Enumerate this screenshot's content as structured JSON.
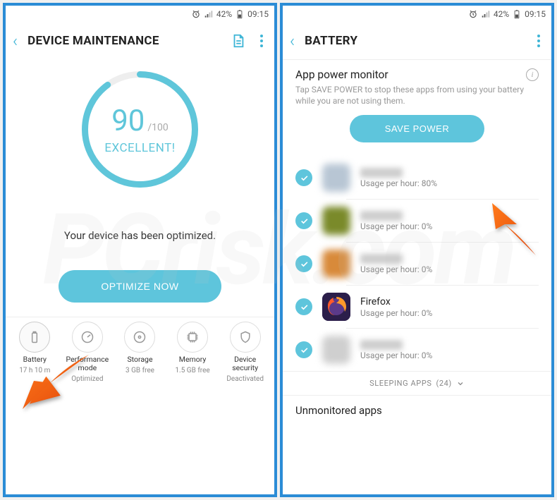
{
  "status": {
    "battery_pct": "42%",
    "time": "09:15"
  },
  "screen1": {
    "title": "DEVICE MAINTENANCE",
    "score": "90",
    "score_max": "/100",
    "rating": "EXCELLENT!",
    "message": "Your device has been optimized.",
    "optimize_btn": "OPTIMIZE NOW",
    "tiles": [
      {
        "label": "Battery",
        "sub": "17 h 10 m"
      },
      {
        "label": "Performance mode",
        "sub": "Optimized"
      },
      {
        "label": "Storage",
        "sub": "3 GB free"
      },
      {
        "label": "Memory",
        "sub": "1.5 GB free"
      },
      {
        "label": "Device security",
        "sub": "Deactivated"
      }
    ]
  },
  "screen2": {
    "title": "BATTERY",
    "section_title": "App power monitor",
    "section_desc": "Tap SAVE POWER to stop these apps from using your battery while you are not using them.",
    "save_btn": "SAVE POWER",
    "apps": [
      {
        "name": "",
        "usage": "Usage per hour: 80%",
        "blurred": true,
        "iconColor": "#b8c6d4"
      },
      {
        "name": "",
        "usage": "Usage per hour: 0%",
        "blurred": true,
        "iconColor": "#7a8a2a"
      },
      {
        "name": "",
        "usage": "Usage per hour: 0%",
        "blurred": true,
        "iconColor": "#d88a3a"
      },
      {
        "name": "Firefox",
        "usage": "Usage per hour: 0%",
        "blurred": false,
        "iconColor": "#2b1e4a"
      },
      {
        "name": "",
        "usage": "Usage per hour: 0%",
        "blurred": true,
        "iconColor": "#cfcfcf"
      }
    ],
    "sleeping_label": "SLEEPING APPS",
    "sleeping_count": "(24)",
    "unmonitored_title": "Unmonitored apps"
  },
  "watermark_text": "PCrisk.com"
}
